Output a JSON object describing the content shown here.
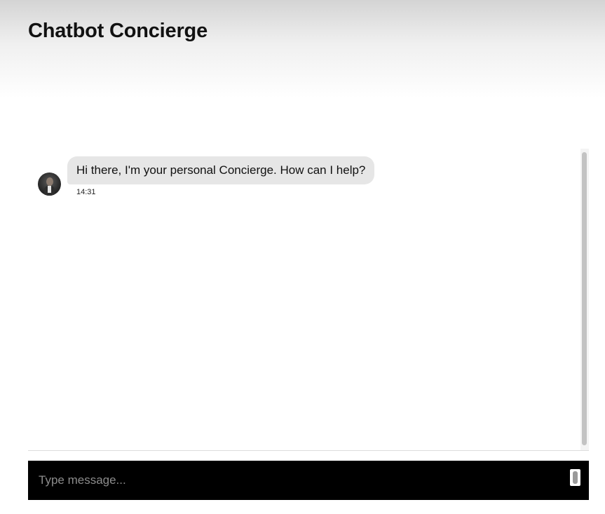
{
  "header": {
    "title": "Chatbot Concierge"
  },
  "chat": {
    "messages": [
      {
        "sender": "bot",
        "avatar_icon": "bot-avatar-icon",
        "text": "Hi there, I'm your personal Concierge. How can I help?",
        "time": "14:31"
      }
    ]
  },
  "composer": {
    "placeholder": "Type message...",
    "value": ""
  },
  "colors": {
    "bubble": "#e6e6e6",
    "composer_background": "#000000",
    "header_gradient_top": "#d4d4d4"
  }
}
